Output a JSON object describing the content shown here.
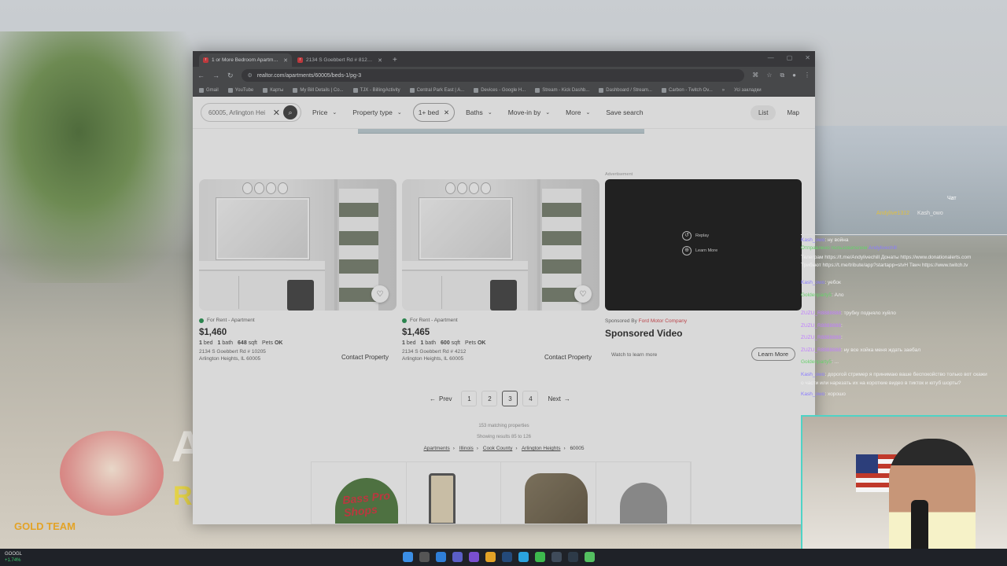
{
  "browser": {
    "tabs": [
      {
        "title": "1 or More Bedroom Apartments",
        "active": true
      },
      {
        "title": "2134 S Goebbert Rd # 8121, Arlington Heights",
        "active": false
      }
    ],
    "new_tab": "+",
    "url": "realtor.com/apartments/60005/beds-1/pg-3",
    "bookmarks": [
      "Gmail",
      "YouTube",
      "Карты",
      "My Bill Details | Co...",
      "TJX - BillingActivity",
      "Central Park East | A...",
      "Devices - Google H...",
      "Stream - Kick Dashb...",
      "Dashboard / Stream...",
      "Carbon - Twitch Ov..."
    ],
    "bookmarks_more": "»",
    "all_bookmarks": "Усі закладки"
  },
  "filters": {
    "search_value": "60005, Arlington Hei",
    "price": "Price",
    "property_type": "Property type",
    "beds": "1+ bed",
    "baths": "Baths",
    "move_in": "Move-in by",
    "more": "More",
    "save_search": "Save search",
    "list": "List",
    "map": "Map"
  },
  "advertisement_label": "Advertisement",
  "listings": [
    {
      "status": "For Rent - Apartment",
      "price": "$1,460",
      "beds": "1",
      "beds_label": "bed",
      "baths": "1",
      "baths_label": "bath",
      "sqft": "648",
      "sqft_label": "sqft",
      "pets": "Pets",
      "pets_value": "OK",
      "address1": "2134 S Goebbert Rd # 10205",
      "address2": "Arlington Heights, IL 60005",
      "contact": "Contact Property"
    },
    {
      "status": "For Rent - Apartment",
      "price": "$1,465",
      "beds": "1",
      "beds_label": "bed",
      "baths": "1",
      "baths_label": "bath",
      "sqft": "600",
      "sqft_label": "sqft",
      "pets": "Pets",
      "pets_value": "OK",
      "address1": "2134 S Goebbert Rd # 4212",
      "address2": "Arlington Heights, IL 60005",
      "contact": "Contact Property"
    }
  ],
  "ad": {
    "replay": "Replay",
    "learn_more_overlay": "Learn More",
    "sponsored_by": "Sponsored By",
    "sponsor": "Ford Motor Company",
    "title": "Sponsored Video",
    "watch": "Watch to learn more",
    "learn_more": "Learn More"
  },
  "pagination": {
    "prev": "Prev",
    "pages": [
      "1",
      "2",
      "3",
      "4"
    ],
    "current": "3",
    "next": "Next"
  },
  "summary": {
    "matching": "153 matching properties",
    "showing": "Showing results 85 to 126"
  },
  "breadcrumbs": [
    "Apartments",
    "Illinois",
    "Cook County",
    "Arlington Heights",
    "60005"
  ],
  "ad_strip": {
    "brand": "Bass Pro Shops"
  },
  "chat": {
    "header": "Чат",
    "viewers": [
      "Andylive1312",
      "Kash_owo"
    ],
    "lines": [
      {
        "user": "Kash_owo",
        "text": ": ну война"
      },
      {
        "user": "Отправлено пользователем",
        "text": " Andylivechill"
      },
      {
        "user": "Телеграм",
        "text": " https://t.me/Andylivechill Донаты https://www.donationalerts.com"
      },
      {
        "user": "Трибьют",
        "text": " https://t.me/tribute/app?startapp=stvH Твич https://www.twitch.tv"
      },
      {
        "user": "Kash_owo",
        "text": ": уебок"
      },
      {
        "user": "Goldenparty5",
        "text": ": Ало"
      },
      {
        "user": "ZUZU_R8888888",
        "text": ": трубку подняло хуйло"
      },
      {
        "user": "ZUZU_R8888888",
        "text": ": "
      },
      {
        "user": "ZUZU_R8888888",
        "text": ": "
      },
      {
        "user": "ZUZU_R8888888",
        "text": ": ну все хойка меня ждать заебал"
      },
      {
        "user": "Goldenparty5",
        "text": ": ..."
      },
      {
        "user": "Kash_owo",
        "text": ": дорогой стример я принимаю ваше беспокойство только вот скажи"
      },
      {
        "user": "",
        "text": "о части или нарезать их на короткие видео в тикток и ютуб шорты?"
      },
      {
        "user": "Kash_owo",
        "text": ": хорошо"
      }
    ]
  },
  "taskbar": {
    "ticker": "GOOGL",
    "change": "+1.74%"
  },
  "stream_overlay": {
    "big_letter": "A",
    "small_letter": "R",
    "logo": "GOLD TEAM"
  }
}
